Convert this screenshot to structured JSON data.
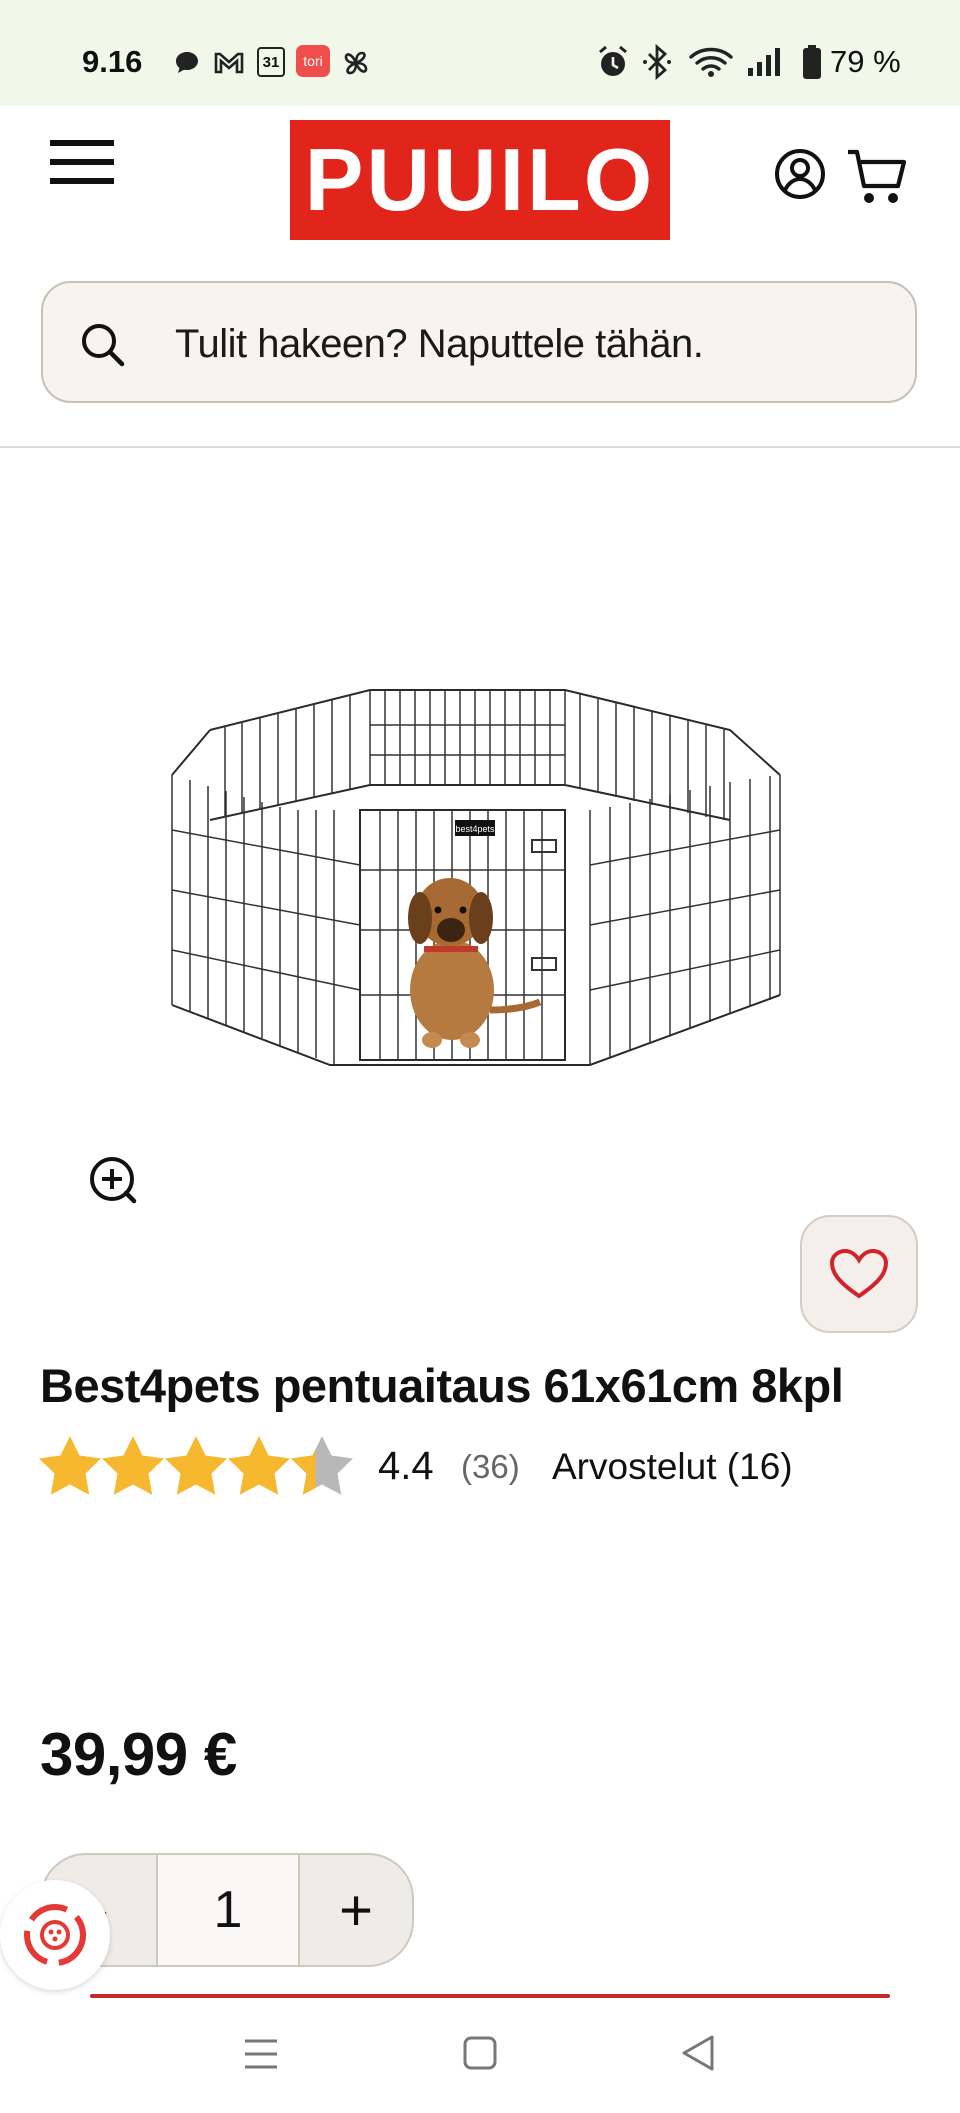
{
  "status_bar": {
    "time": "9.16",
    "battery": "79 %",
    "app_badge": "tori",
    "calendar_day": "31"
  },
  "header": {
    "logo_text": "PUUILO"
  },
  "search": {
    "placeholder": "Tulit hakeen? Naputtele tähän."
  },
  "product": {
    "title": "Best4pets pentuaitaus 61x61cm 8kpl",
    "rating_value": "4.4",
    "rating_fraction": 0.88,
    "rating_count": "(36)",
    "reviews_link": "Arvostelut (16)",
    "price": "39,99 €",
    "quantity": "1",
    "qty_minus_label": "-",
    "qty_plus_label": "+",
    "image_brand_tag": "best4pets"
  },
  "colors": {
    "brand_red": "#e1251b",
    "star_gold": "#f5b82e",
    "star_empty": "#b8b8b8",
    "status_bg": "#f1f8e9"
  }
}
